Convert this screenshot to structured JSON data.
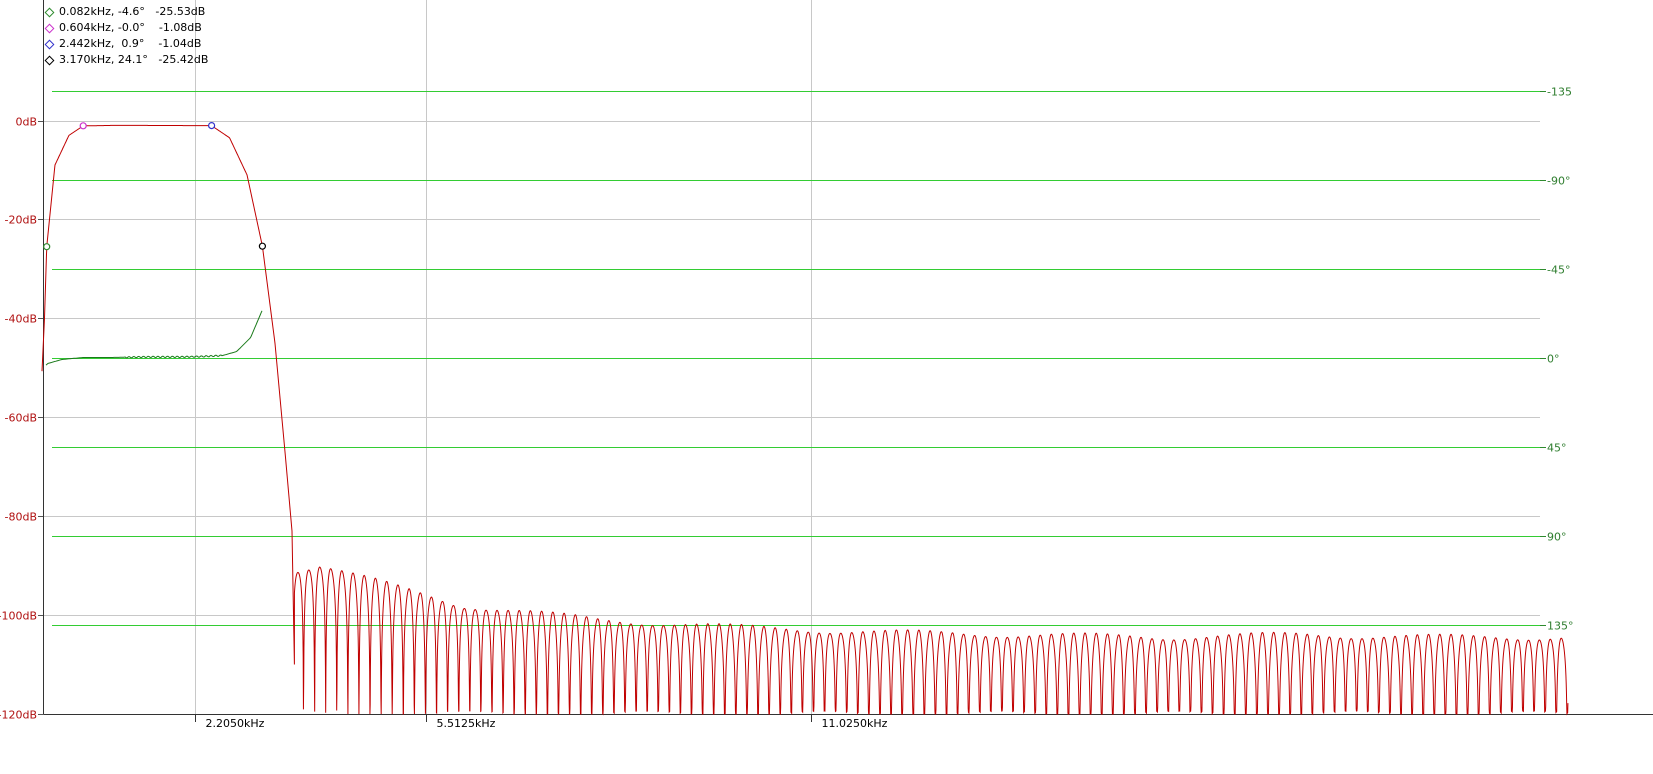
{
  "chart_data": {
    "type": "line",
    "y_left": {
      "range": [
        -120,
        8
      ],
      "ticks": [
        {
          "value": 0,
          "label": "0dB"
        },
        {
          "value": -20,
          "label": "-20dB"
        },
        {
          "value": -40,
          "label": "-40dB"
        },
        {
          "value": -60,
          "label": "-60dB"
        },
        {
          "value": -80,
          "label": "-80dB"
        },
        {
          "value": -100,
          "label": "-100dB"
        },
        {
          "value": -120,
          "label": "-120dB"
        }
      ]
    },
    "y_right": {
      "unit": "degrees",
      "ticks": [
        {
          "value": -135,
          "label": "-135"
        },
        {
          "value": -90,
          "label": "-90°"
        },
        {
          "value": -45,
          "label": "-45°"
        },
        {
          "value": 0,
          "label": "0°"
        },
        {
          "value": 45,
          "label": "45°"
        },
        {
          "value": 90,
          "label": "90°"
        },
        {
          "value": 135,
          "label": "135°"
        }
      ]
    },
    "x_axis": {
      "unit": "kHz",
      "range": [
        0,
        20.0
      ],
      "ticks": [
        {
          "value": 2.205,
          "label": "2.2050kHz"
        },
        {
          "value": 5.5125,
          "label": "5.5125kHz"
        },
        {
          "value": 11.025,
          "label": "11.0250kHz"
        }
      ]
    },
    "markers": [
      {
        "label": "0.082kHz, -4.6°   -25.53dB",
        "freq": 0.082,
        "phase": -4.6,
        "db": -25.53,
        "color": "#2e8b2e"
      },
      {
        "label": "0.604kHz, -0.0°    -1.08dB",
        "freq": 0.604,
        "phase": 0.0,
        "db": -1.08,
        "color": "#cc33cc"
      },
      {
        "label": "2.442kHz,  0.9°    -1.04dB",
        "freq": 2.442,
        "phase": 0.9,
        "db": -1.04,
        "color": "#3333cc"
      },
      {
        "label": "3.170kHz, 24.1°   -25.42dB",
        "freq": 3.17,
        "phase": 24.1,
        "db": -25.42,
        "color": "#000000"
      }
    ],
    "series": [
      {
        "kind": "magnitude",
        "color": "#c00000",
        "passband": {
          "x": [
            0.0,
            0.05,
            0.082,
            0.2,
            0.4,
            0.604,
            1.0,
            1.5,
            2.0,
            2.442,
            2.7,
            2.95,
            3.17,
            3.35,
            3.5,
            3.6
          ],
          "y": [
            -55,
            -40,
            -25.53,
            -9,
            -3,
            -1.08,
            -1.0,
            -1.0,
            -1.02,
            -1.04,
            -3.5,
            -11,
            -25.42,
            -45,
            -68,
            -84
          ]
        },
        "stopband_envelope": {
          "x": [
            3.6,
            4.0,
            5.0,
            6.0,
            8.0,
            10.0,
            12.0,
            14.0,
            16.0,
            18.0,
            20.0
          ],
          "y": [
            -91,
            -90,
            -94,
            -98,
            -101,
            -102.5,
            -103.5,
            -104,
            -104.5,
            -104,
            -104.5
          ]
        },
        "stopband_lobes_per_khz": 6.3,
        "floor": -120
      },
      {
        "kind": "phase",
        "color": "#1a7a1a",
        "x": [
          0.0,
          0.1,
          0.3,
          0.6,
          1.0,
          1.5,
          2.0,
          2.3,
          2.6,
          2.8,
          3.0,
          3.17
        ],
        "y": [
          -6,
          -3,
          -1,
          0.0,
          0.0,
          0.3,
          0.3,
          0.5,
          1.0,
          3.0,
          10.0,
          24.1
        ]
      }
    ]
  }
}
